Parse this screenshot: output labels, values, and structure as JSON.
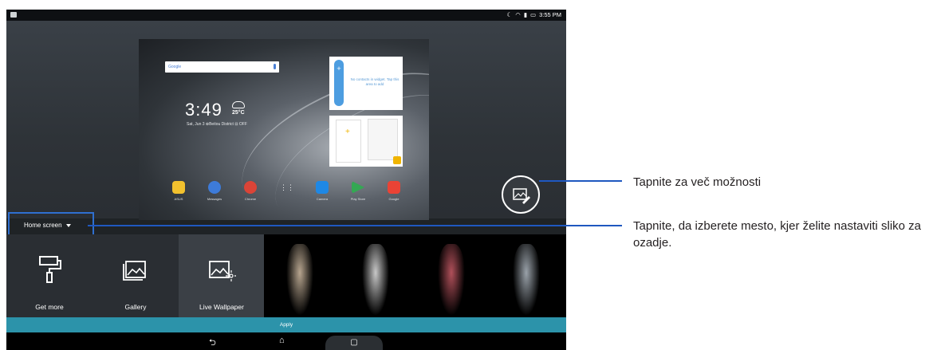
{
  "status_bar": {
    "time": "3:55 PM",
    "icons": [
      "moon-icon",
      "wifi-icon",
      "signal-icon",
      "battery-icon"
    ]
  },
  "preview": {
    "search_label": "Google",
    "clock": "3:49",
    "temperature": "25°C",
    "date_line": "Sat, Jun 3  ⊕Beitou District  ⊟ OFF",
    "widget_text": "No contacts in widget. Tap this area to add",
    "apps": [
      {
        "label": "ASUS",
        "color": "#f2c12e"
      },
      {
        "label": "Messages",
        "color": "#3d7bd9"
      },
      {
        "label": "Chrome",
        "color": "#db4437"
      },
      {
        "label": "",
        "color": "#2a2e33"
      },
      {
        "label": "Camera",
        "color": "#1e88e5"
      },
      {
        "label": "Play Store",
        "color": "#34a853"
      },
      {
        "label": "Google",
        "color": "#ea4335"
      }
    ]
  },
  "location_selector": {
    "label": "Home screen"
  },
  "options": [
    {
      "label": "Get more",
      "icon": "paint-roller-icon"
    },
    {
      "label": "Gallery",
      "icon": "gallery-icon"
    },
    {
      "label": "Live Wallpaper",
      "icon": "live-wallpaper-icon"
    }
  ],
  "thumbnails": [
    {
      "color": "#b7a58f"
    },
    {
      "color": "#c8c8c8"
    },
    {
      "color": "#b0505a"
    },
    {
      "color": "#9aa2aa"
    }
  ],
  "apply_label": "Apply",
  "nav": {
    "back": "⮌",
    "home": "⌂",
    "recents": "▢"
  },
  "annotations": {
    "more_options": "Tapnite za več možnosti",
    "choose_location": "Tapnite, da izberete mesto, kjer želite nastaviti sliko za ozadje."
  },
  "colors": {
    "accent": "#2c93aa",
    "callout": "#1f58c0"
  }
}
